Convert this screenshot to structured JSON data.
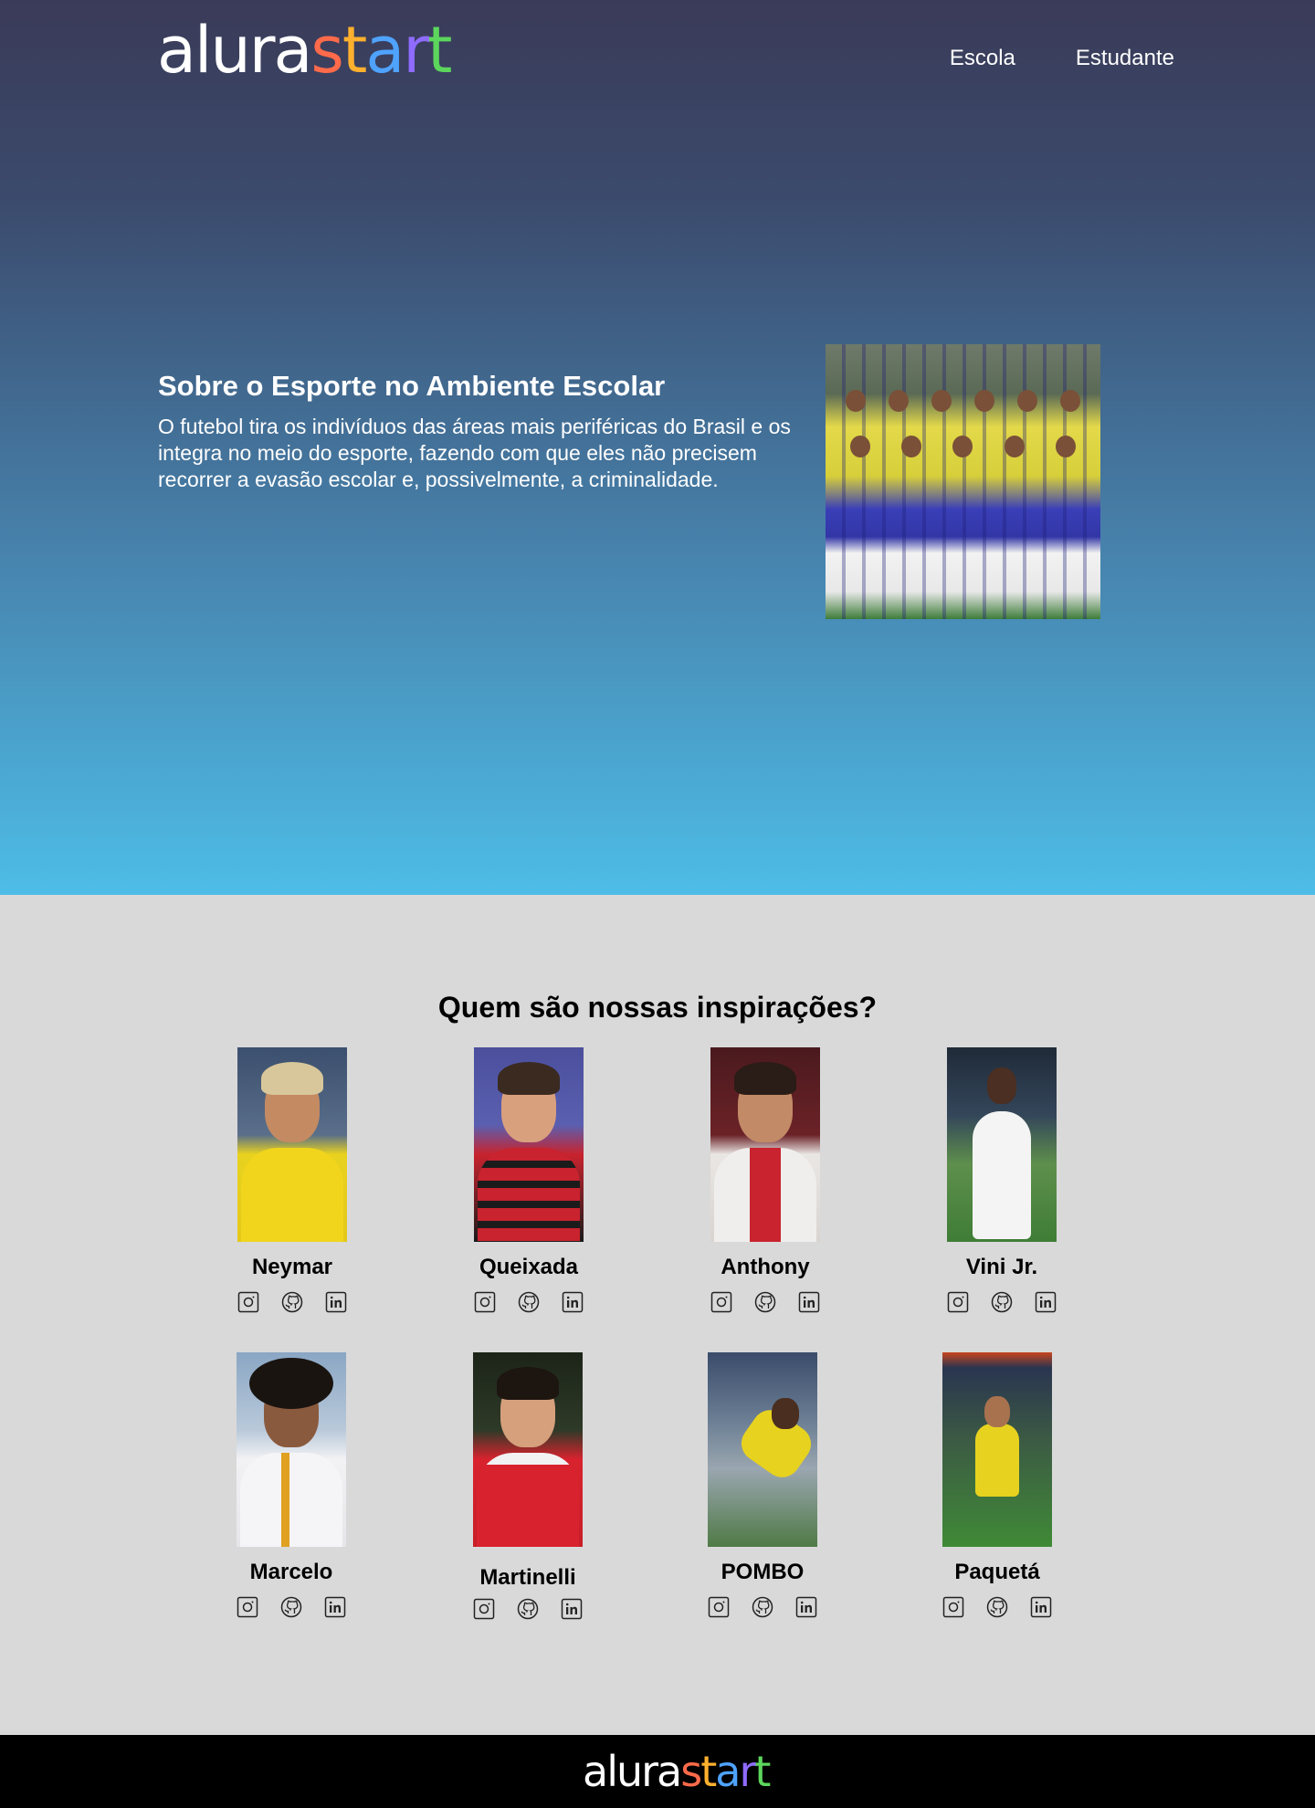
{
  "brand": {
    "logo_part1": "alura",
    "logo_part2": "start",
    "colors": {
      "white": "#ffffff",
      "s": "#ff6b4a",
      "t": "#ffb02e",
      "a": "#4fa3ff",
      "r": "#8f6bff",
      "t2": "#5cd65c"
    }
  },
  "nav": {
    "items": [
      {
        "label": "Escola"
      },
      {
        "label": "Estudante"
      }
    ]
  },
  "hero": {
    "title": "Sobre o Esporte no Ambiente Escolar",
    "text": "O futebol tira os indivíduos das áreas mais periféricas do Brasil e os integra no meio do esporte, fazendo com que eles não precisem recorrer a evasão escolar e, possivelmente, a criminalidade.",
    "image": "team-photo"
  },
  "inspirations": {
    "title": "Quem são nossas inspirações?",
    "players": [
      {
        "name": "Neymar"
      },
      {
        "name": "Queixada"
      },
      {
        "name": "Anthony"
      },
      {
        "name": "Vini Jr."
      },
      {
        "name": "Marcelo"
      },
      {
        "name": "Martinelli"
      },
      {
        "name": "POMBO"
      },
      {
        "name": "Paquetá"
      }
    ],
    "social_icons": [
      "instagram-icon",
      "github-icon",
      "linkedin-icon"
    ]
  },
  "footer": {
    "logo_part1": "alura",
    "logo_part2": "start"
  },
  "colors": {
    "hero_top": "#3a3b58",
    "hero_bottom": "#4dbde7",
    "section_bg": "#d9d9d9",
    "footer_bg": "#000000"
  }
}
